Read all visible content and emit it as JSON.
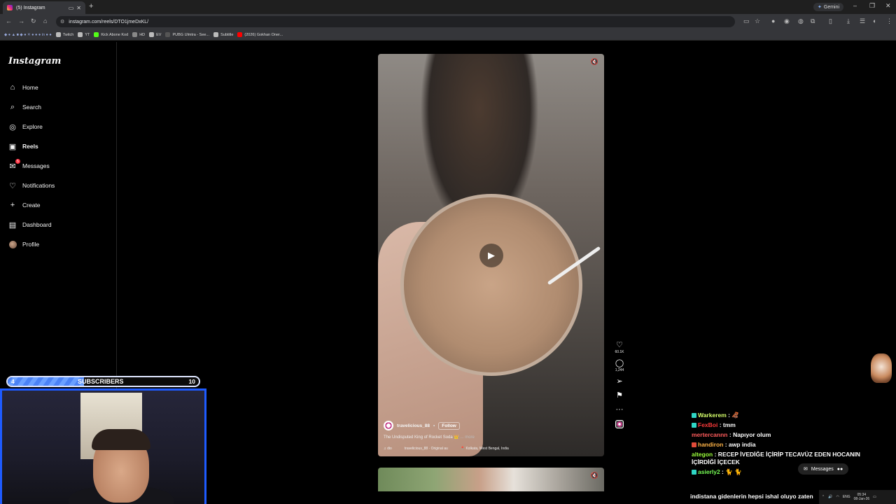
{
  "browser": {
    "tab_title": "(5) Instagram",
    "url": "instagram.com/reels/DTO1jmeDxKL/",
    "gemini_label": "Gemini",
    "bookmarks": [
      {
        "label": "Twitch",
        "color": "#bbbbbb"
      },
      {
        "label": "YT",
        "color": "#bbbbbb"
      },
      {
        "label": "Kick Abone Kod",
        "color": "#53fc18"
      },
      {
        "label": "HD",
        "color": "#888888"
      },
      {
        "label": "EV",
        "color": "#bbbbbb"
      },
      {
        "label": "PUBG Ulmtra - See...",
        "color": "#555555"
      },
      {
        "label": "Subtitle",
        "color": "#bbbbbb"
      },
      {
        "label": "(2026) Gokhan Oner...",
        "color": "#ff0000"
      }
    ]
  },
  "sidebar": {
    "logo": "Instagram",
    "items": [
      {
        "label": "Home",
        "icon": "home-icon",
        "glyph": "⌂"
      },
      {
        "label": "Search",
        "icon": "search-icon",
        "glyph": "⌕"
      },
      {
        "label": "Explore",
        "icon": "compass-icon",
        "glyph": "◎"
      },
      {
        "label": "Reels",
        "icon": "reels-icon",
        "glyph": "▣"
      },
      {
        "label": "Messages",
        "icon": "messenger-icon",
        "glyph": "✉",
        "badge": "5"
      },
      {
        "label": "Notifications",
        "icon": "heart-icon",
        "glyph": "♡"
      },
      {
        "label": "Create",
        "icon": "plus-icon",
        "glyph": "+"
      },
      {
        "label": "Dashboard",
        "icon": "dashboard-icon",
        "glyph": "▤"
      },
      {
        "label": "Profile",
        "icon": "avatar",
        "glyph": ""
      }
    ]
  },
  "reel": {
    "username": "travelicious_88",
    "follow_label": "Follow",
    "caption": "The Undisputed King of Rocket Soda 👑",
    "more_label": "... more",
    "audio_user": "dio",
    "audio_track": "travelicious_88 · Original au",
    "location": "Kolkata, West Bengal, India",
    "likes": "60.1K",
    "comments": "1,244"
  },
  "stream": {
    "subs_current": "4",
    "subs_label": "SUBSCRIBERS",
    "subs_goal": "10",
    "subs_progress": 0.4,
    "chat": [
      {
        "user": "Warkerem",
        "text": ": 🦧",
        "color": "#d6ff6b",
        "badge": "#2fd6c5"
      },
      {
        "user": "FexBoi",
        "text": ": tmm",
        "color": "#ff3b3b",
        "badge": "#2fd6c5"
      },
      {
        "user": "mertercannn",
        "text": ": Napıyor olum",
        "color": "#ff5c5c",
        "badge": ""
      },
      {
        "user": "handiron",
        "text": ": awp india",
        "color": "#ffb347",
        "badge": "#e04b3a"
      },
      {
        "user": "altegon",
        "text": ": RECEP İVEDİĞE İÇİRİP TECAVÜZ EDEN HOCANIN İÇİRDİĞİ İÇECEK",
        "color": "#9bff3b",
        "badge": ""
      },
      {
        "user": "asierly2",
        "text": ": 🐈 🐈",
        "color": "#77ff55",
        "badge": "#2fd6c5"
      }
    ],
    "messages_label": "Messages",
    "ticker": "indistana gidenlerin hepsi ishal oluyo zaten"
  },
  "taskbar": {
    "lang": "ENG",
    "time": "05:34",
    "date": "08-Jan-26"
  },
  "colors": {
    "accent": "#1e5bff",
    "instagram_bg": "#000000"
  }
}
